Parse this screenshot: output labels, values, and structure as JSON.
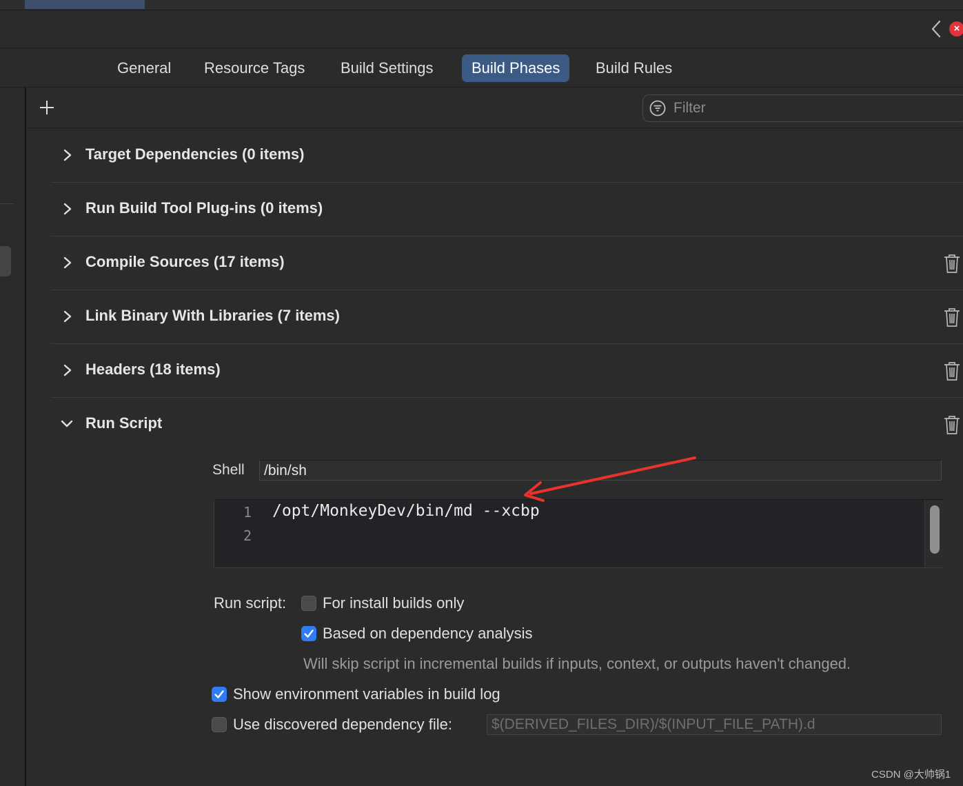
{
  "tabs": [
    {
      "label": "General"
    },
    {
      "label": "Resource Tags"
    },
    {
      "label": "Build Settings"
    },
    {
      "label": "Build Phases",
      "active": true
    },
    {
      "label": "Build Rules"
    }
  ],
  "toolbar": {
    "filter_placeholder": "Filter"
  },
  "phases": [
    {
      "title": "Target Dependencies (0 items)",
      "expanded": false,
      "deletable": false
    },
    {
      "title": "Run Build Tool Plug-ins (0 items)",
      "expanded": false,
      "deletable": false
    },
    {
      "title": "Compile Sources (17 items)",
      "expanded": false,
      "deletable": true
    },
    {
      "title": "Link Binary With Libraries (7 items)",
      "expanded": false,
      "deletable": true
    },
    {
      "title": "Headers (18 items)",
      "expanded": false,
      "deletable": true
    },
    {
      "title": "Run Script",
      "expanded": true,
      "deletable": true
    }
  ],
  "run_script": {
    "shell_label": "Shell",
    "shell_value": "/bin/sh",
    "code_lines": [
      {
        "num": "1",
        "text": "/opt/MonkeyDev/bin/md --xcbp"
      },
      {
        "num": "2",
        "text": ""
      }
    ],
    "run_script_label": "Run script:",
    "install_builds_only": {
      "label": "For install builds only",
      "checked": false
    },
    "dependency_analysis": {
      "label": "Based on dependency analysis",
      "checked": true
    },
    "skip_note": "Will skip script in incremental builds if inputs, context, or outputs haven't changed.",
    "show_env_vars": {
      "label": "Show environment variables in build log",
      "checked": true
    },
    "use_dep_file": {
      "label": "Use discovered dependency file:",
      "checked": false
    },
    "dep_file_placeholder": "$(DERIVED_FILES_DIR)/$(INPUT_FILE_PATH).d"
  },
  "colors": {
    "background": "#2b2b2b",
    "active_tab": "#3c5b84",
    "checkbox_checked": "#2f7cf6",
    "annotation_arrow": "#e8322c",
    "close_badge": "#e0333a"
  },
  "icons": {
    "back": "chevron-left-icon",
    "close": "close-icon",
    "add": "plus-icon",
    "filter": "filter-icon",
    "disclosure_collapsed": "chevron-right-icon",
    "disclosure_expanded": "chevron-down-icon",
    "delete": "trash-icon"
  },
  "watermark": "CSDN @大帅锅1"
}
